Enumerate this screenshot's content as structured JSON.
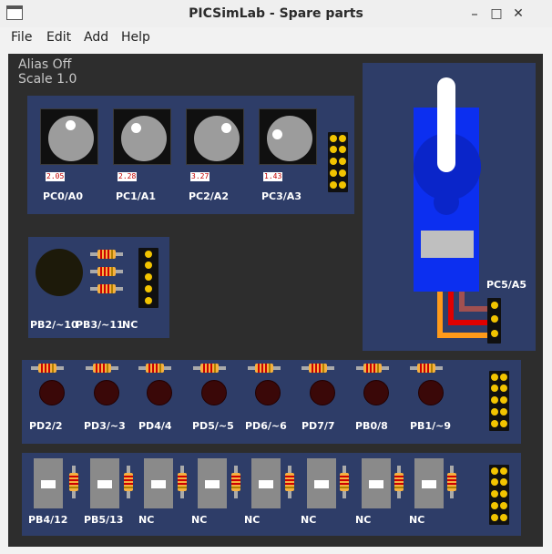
{
  "window": {
    "title": "PICSimLab - Spare parts",
    "minimize": "–",
    "maximize": "□",
    "close": "✕"
  },
  "menu": [
    "File",
    "Edit",
    "Add",
    "Help"
  ],
  "info": {
    "alias": "Alias Off",
    "scale": "Scale 1.0"
  },
  "potentiometers": [
    {
      "label": "PC0/A0",
      "value": "2.05"
    },
    {
      "label": "PC1/A1",
      "value": "2.28"
    },
    {
      "label": "PC2/A2",
      "value": "3.27"
    },
    {
      "label": "PC3/A3",
      "value": "1.43"
    }
  ],
  "buzzer": {
    "labels": [
      "PB2/~10",
      "PB3/~11",
      "NC"
    ]
  },
  "servo": {
    "label": "PC5/A5"
  },
  "leds": [
    "PD2/2",
    "PD3/~3",
    "PD4/4",
    "PD5/~5",
    "PD6/~6",
    "PD7/7",
    "PB0/8",
    "PB1/~9"
  ],
  "push_buttons": [
    "PB4/12",
    "PB5/13",
    "NC",
    "NC",
    "NC",
    "NC",
    "NC",
    "NC"
  ],
  "colors": {
    "canvas": "#2d2d2d",
    "panel": "#2e3d68",
    "servo_body": "#0c2ff0",
    "pin": "#f2c400",
    "resistor": "#f6b040",
    "led_off": "#3a0808"
  }
}
